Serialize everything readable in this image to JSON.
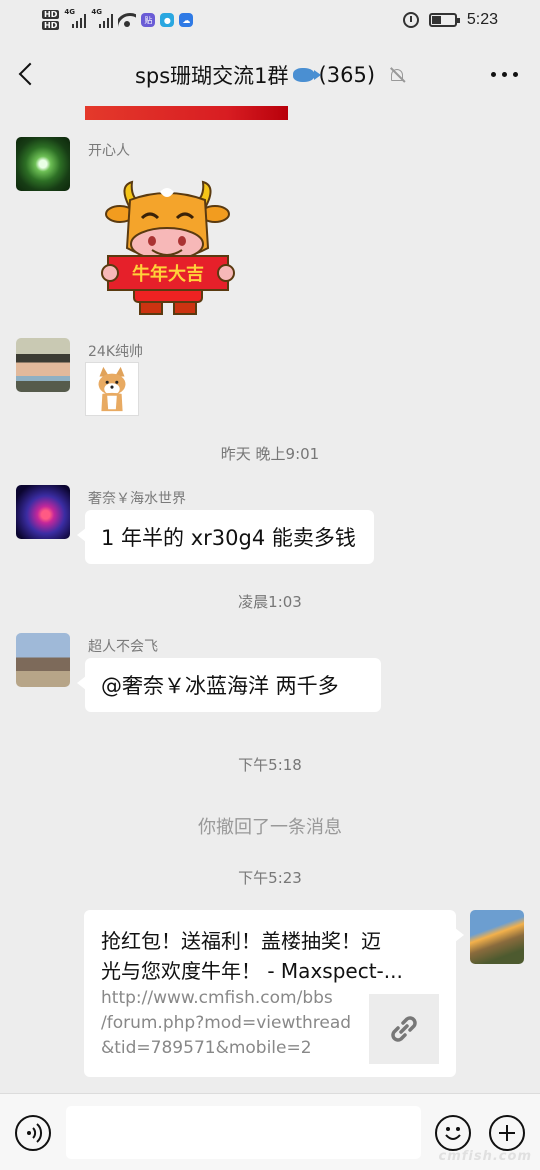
{
  "status_bar": {
    "left": {
      "hd": "HD",
      "network": "4G",
      "app_badge": "贴"
    },
    "time": "5:23"
  },
  "header": {
    "title": "sps珊瑚交流1群",
    "member_count": "(365)"
  },
  "messages": [
    {
      "type": "sticker",
      "sender": "开心人",
      "sticker_text": "牛年大吉"
    },
    {
      "type": "image",
      "sender": "24K纯帅"
    },
    {
      "type": "timestamp",
      "text": "昨天 晚上9:01"
    },
    {
      "type": "text",
      "sender": "奢奈￥海水世界",
      "text": "1 年半的 xr30g4 能卖多钱"
    },
    {
      "type": "timestamp",
      "text": "凌晨1:03"
    },
    {
      "type": "text",
      "sender": "超人不会飞",
      "text": "@奢奈￥冰蓝海洋  两千多"
    },
    {
      "type": "timestamp",
      "text": "下午5:18"
    },
    {
      "type": "system",
      "text": "你撤回了一条消息"
    },
    {
      "type": "timestamp",
      "text": "下午5:23"
    },
    {
      "type": "link",
      "from_self": true,
      "title_line1": "抢红包！送福利！盖楼抽奖！迈",
      "title_line2": "光与您欢度牛年！ - Maxspect-...",
      "url_line1": "http://www.cmfish.com/bbs",
      "url_line2": "/forum.php?mod=viewthread",
      "url_line3": "&tid=789571&mobile=2"
    }
  ],
  "input_bar": {
    "placeholder": ""
  },
  "watermark": "cmfish.com",
  "colors": {
    "background": "#ededed",
    "bubble": "#ffffff",
    "red_banner": "#d81d22"
  }
}
